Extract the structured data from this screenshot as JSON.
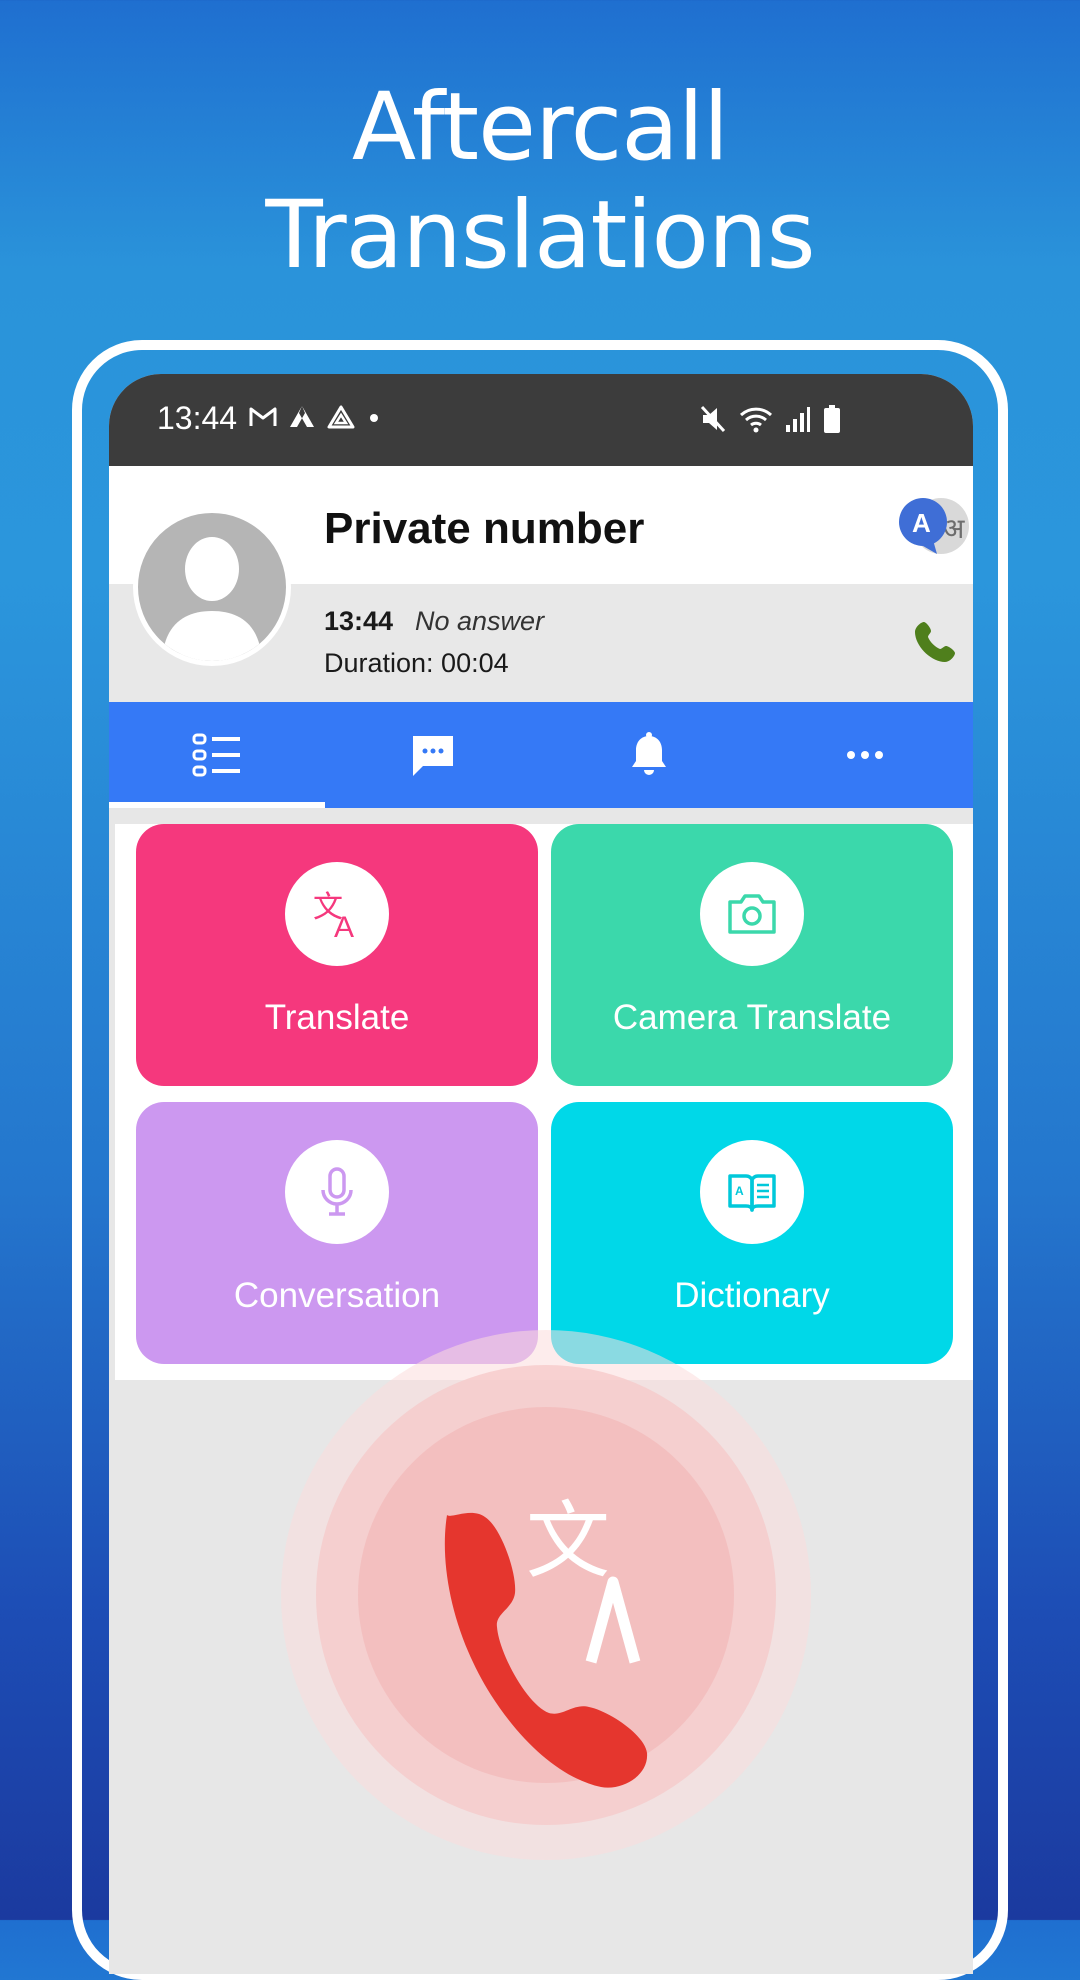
{
  "headline": {
    "line1": "Aftercall",
    "line2": "Translations"
  },
  "status_bar": {
    "time": "13:44",
    "left_icons": [
      "gmail-icon",
      "drive-icon",
      "triangle-app-icon",
      "dot-icon"
    ],
    "right_icons": [
      "mute-icon",
      "wifi-icon",
      "signal-icon",
      "battery-icon"
    ]
  },
  "caller": {
    "name": "Private number",
    "time": "13:44",
    "status": "No answer",
    "duration": "Duration: 00:04"
  },
  "tabs": [
    {
      "icon": "list-icon",
      "active": true
    },
    {
      "icon": "message-icon",
      "active": false
    },
    {
      "icon": "bell-icon",
      "active": false
    },
    {
      "icon": "more-icon",
      "active": false
    }
  ],
  "features": [
    {
      "label": "Translate",
      "color": "#f5387d",
      "icon": "translate-icon"
    },
    {
      "label": "Camera Translate",
      "color": "#3bd8ab",
      "icon": "camera-icon"
    },
    {
      "label": "Conversation",
      "color": "#cc98f0",
      "icon": "microphone-icon"
    },
    {
      "label": "Dictionary",
      "color": "#00d8e8",
      "icon": "book-icon"
    }
  ],
  "colors": {
    "tab_bar": "#3579f6",
    "status_bar": "#3c3c3c",
    "call_button": "#e5362e"
  }
}
